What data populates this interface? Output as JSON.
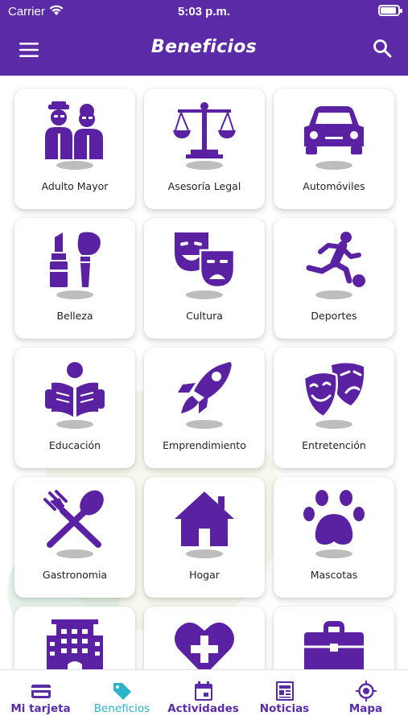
{
  "status_bar": {
    "carrier": "Carrier",
    "time": "5:03 p.m.",
    "battery_level": 0.9
  },
  "app_bar": {
    "title": "Beneficios",
    "menu_icon": "hamburger-menu-icon",
    "search_icon": "search-icon"
  },
  "categories": [
    {
      "label": "Adulto Mayor",
      "icon": "elderly-couple-icon"
    },
    {
      "label": "Asesoría Legal",
      "icon": "scales-icon"
    },
    {
      "label": "Automóviles",
      "icon": "car-icon"
    },
    {
      "label": "Belleza",
      "icon": "lipstick-brush-icon"
    },
    {
      "label": "Cultura",
      "icon": "theater-masks-icon"
    },
    {
      "label": "Deportes",
      "icon": "soccer-player-icon"
    },
    {
      "label": "Educación",
      "icon": "reading-person-icon"
    },
    {
      "label": "Emprendimiento",
      "icon": "rocket-icon"
    },
    {
      "label": "Entretención",
      "icon": "comedy-masks-icon"
    },
    {
      "label": "Gastronomia",
      "icon": "fork-spoon-icon"
    },
    {
      "label": "Hogar",
      "icon": "house-icon"
    },
    {
      "label": "Mascotas",
      "icon": "paw-icon"
    },
    {
      "label": "",
      "icon": "building-icon"
    },
    {
      "label": "",
      "icon": "heart-plus-icon"
    },
    {
      "label": "",
      "icon": "briefcase-icon"
    }
  ],
  "tab_bar": {
    "tabs": [
      {
        "label": "Mi tarjeta",
        "icon": "card-icon",
        "active": false
      },
      {
        "label": "Beneficios",
        "icon": "tag-icon",
        "active": true
      },
      {
        "label": "Actividades",
        "icon": "calendar-icon",
        "active": false
      },
      {
        "label": "Noticias",
        "icon": "newspaper-icon",
        "active": false
      },
      {
        "label": "Mapa",
        "icon": "location-target-icon",
        "active": false
      }
    ]
  },
  "colors": {
    "brand_purple": "#5b2aa7",
    "icon_purple": "#5a22a3",
    "active_tab": "#2ab3c9"
  }
}
